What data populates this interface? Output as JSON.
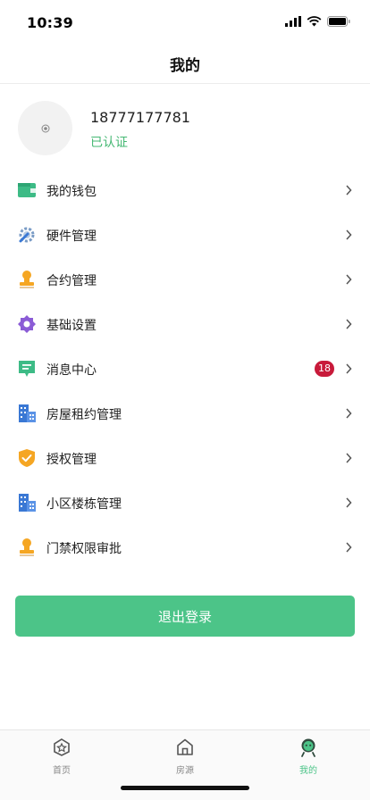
{
  "status_bar": {
    "time": "10:39"
  },
  "nav": {
    "title": "我的"
  },
  "profile": {
    "phone": "18777177781",
    "status": "已认证"
  },
  "menu": {
    "items": [
      {
        "label": "我的钱包",
        "icon": "wallet-icon"
      },
      {
        "label": "硬件管理",
        "icon": "tools-icon"
      },
      {
        "label": "合约管理",
        "icon": "stamp-icon"
      },
      {
        "label": "基础设置",
        "icon": "settings-icon"
      },
      {
        "label": "消息中心",
        "icon": "message-icon",
        "badge": "18"
      },
      {
        "label": "房屋租约管理",
        "icon": "building-icon"
      },
      {
        "label": "授权管理",
        "icon": "shield-check-icon"
      },
      {
        "label": "小区楼栋管理",
        "icon": "building-icon"
      },
      {
        "label": "门禁权限审批",
        "icon": "stamp-icon"
      }
    ]
  },
  "logout": {
    "label": "退出登录"
  },
  "tabs": [
    {
      "label": "首页",
      "icon": "home-star-icon"
    },
    {
      "label": "房源",
      "icon": "house-icon"
    },
    {
      "label": "我的",
      "icon": "profile-icon",
      "active": true
    }
  ],
  "colors": {
    "accent": "#4cc488",
    "verified": "#45b873",
    "badge": "#c81a3a"
  }
}
